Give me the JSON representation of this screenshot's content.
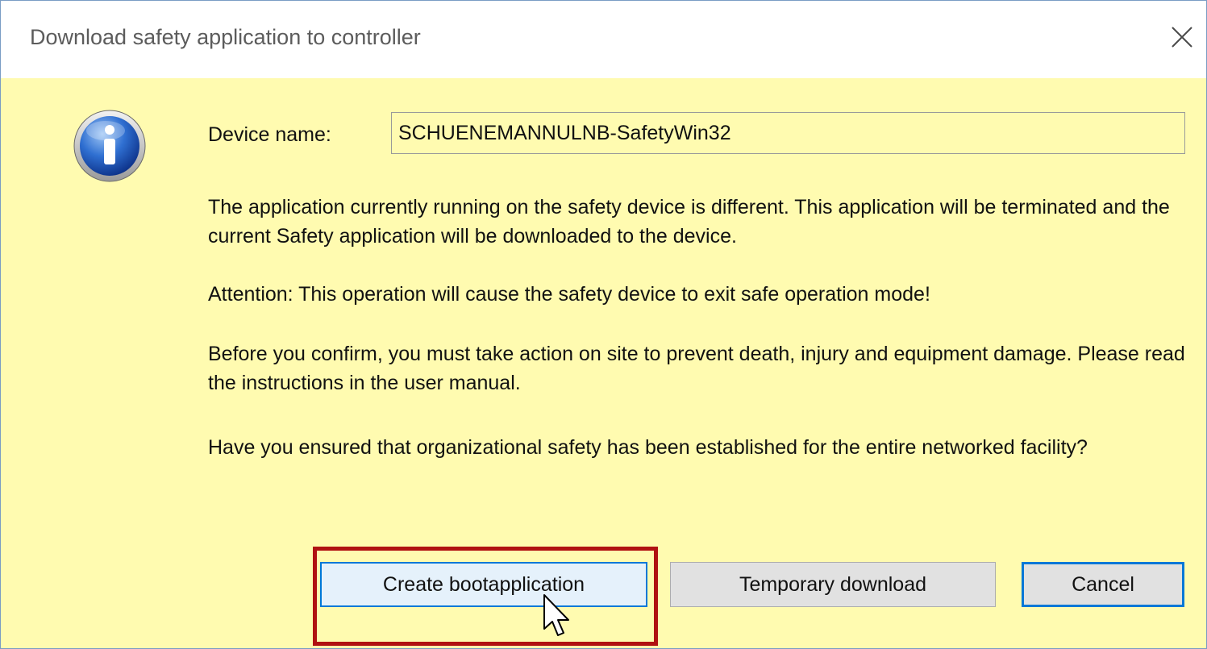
{
  "window": {
    "title": "Download safety application to controller",
    "close_icon": "close-icon"
  },
  "content": {
    "icon": "info-icon",
    "device_label": "Device name:",
    "device_value": "SCHUENEMANNULNB-SafetyWin32",
    "paragraphs": [
      "The application currently running on the safety device is different. This application will be terminated and the current Safety application will be downloaded to the device.",
      "Attention: This operation will cause the safety device to exit safe operation mode!",
      "Before you confirm, you must take action on site to prevent death, injury and equipment damage. Please read the instructions in the user manual.",
      "Have you ensured that organizational safety has been established for the entire networked facility?"
    ]
  },
  "buttons": {
    "create": "Create bootapplication",
    "temporary": "Temporary download",
    "cancel": "Cancel"
  },
  "colors": {
    "background": "#fffbb0",
    "accent": "#0078d7",
    "highlight": "#b01212"
  }
}
